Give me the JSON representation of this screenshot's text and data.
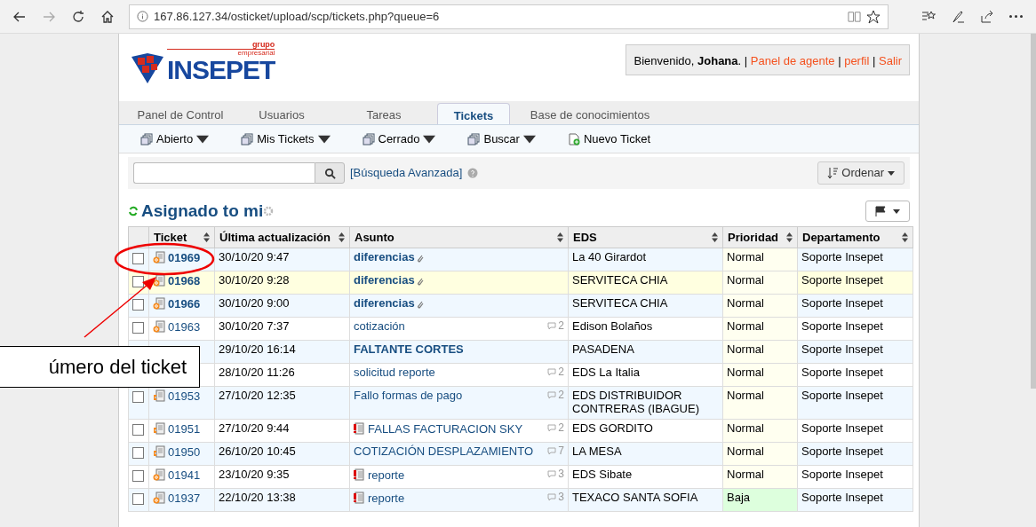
{
  "browser": {
    "url": "167.86.127.34/osticket/upload/scp/tickets.php?queue=6"
  },
  "logo": {
    "small_top": "grupo",
    "small_bottom": "empresarial",
    "name": "INSEPET"
  },
  "welcome": {
    "greeting": "Bienvenido, ",
    "user": "Johana",
    "user_suffix": ".",
    "separator": "|",
    "links": [
      "Panel de agente",
      "perfil",
      "Salir"
    ]
  },
  "tabs": [
    {
      "label": "Panel de Control",
      "selected": false
    },
    {
      "label": "Usuarios",
      "selected": false
    },
    {
      "label": "Tareas",
      "selected": false
    },
    {
      "label": "Tickets",
      "selected": true
    },
    {
      "label": "Base de conocimientos",
      "selected": false
    }
  ],
  "subnav": [
    {
      "label": "Abierto",
      "kind": "menu"
    },
    {
      "label": "Mis Tickets",
      "kind": "menu"
    },
    {
      "label": "Cerrado",
      "kind": "menu"
    },
    {
      "label": "Buscar",
      "kind": "menu"
    },
    {
      "label": "Nuevo Ticket",
      "kind": "new"
    }
  ],
  "search": {
    "advanced": "[Búsqueda Avanzada]",
    "sort": "Ordenar"
  },
  "queue_title": "Asignado to mi",
  "table": {
    "columns": [
      "Ticket",
      "Última actualización",
      "Asunto",
      "EDS",
      "Prioridad",
      "Departamento"
    ],
    "rows": [
      {
        "ticket": "01969",
        "kind": "email",
        "updated": "30/10/20 9:47",
        "subject": "diferencias",
        "unread": true,
        "attachment": true,
        "alert": false,
        "eds": "La 40 Girardot",
        "priority": "Normal",
        "color": "#fffff0",
        "department": "Soporte Insepet",
        "highlight": false
      },
      {
        "ticket": "01968",
        "kind": "email",
        "updated": "30/10/20 9:28",
        "subject": "diferencias",
        "unread": true,
        "attachment": true,
        "alert": false,
        "eds": "SERVITECA CHIA",
        "priority": "Normal",
        "color": "#fffff0",
        "department": "Soporte Insepet",
        "highlight": true
      },
      {
        "ticket": "01966",
        "kind": "email",
        "updated": "30/10/20 9:00",
        "subject": "diferencias",
        "unread": true,
        "attachment": true,
        "alert": false,
        "eds": "SERVITECA CHIA",
        "priority": "Normal",
        "color": "#fffff0",
        "department": "Soporte Insepet",
        "highlight": false
      },
      {
        "ticket": "01963",
        "kind": "email",
        "updated": "30/10/20 7:37",
        "subject": "cotización",
        "unread": false,
        "attachment": false,
        "alert": false,
        "threads": "2",
        "eds": "Edison Bolaños",
        "priority": "Normal",
        "color": "#fffff0",
        "department": "Soporte Insepet",
        "highlight": false
      },
      {
        "updated": "29/10/20 16:14",
        "subject": "FALTANTE CORTES",
        "unread": true,
        "attachment": false,
        "alert": false,
        "eds": "PASADENA",
        "priority": "Normal",
        "color": "#fffff0",
        "department": "Soporte Insepet",
        "highlight": false
      },
      {
        "updated": "28/10/20 11:26",
        "subject": "solicitud reporte",
        "unread": false,
        "attachment": false,
        "alert": false,
        "threads": "2",
        "eds": "EDS La Italia",
        "priority": "Normal",
        "color": "#fffff0",
        "department": "Soporte Insepet",
        "highlight": false
      },
      {
        "ticket": "01953",
        "kind": "phone",
        "updated": "27/10/20 12:35",
        "subject": "Fallo formas de pago",
        "unread": false,
        "attachment": false,
        "alert": false,
        "threads": "2",
        "eds": "EDS DISTRIBUIDOR CONTRERAS (IBAGUE)",
        "priority": "Normal",
        "color": "#fffff0",
        "department": "Soporte Insepet",
        "highlight": false
      },
      {
        "ticket": "01951",
        "kind": "phone",
        "updated": "27/10/20 9:44",
        "subject": "FALLAS FACTURACION SKY",
        "unread": false,
        "attachment": false,
        "alert": true,
        "threads": "2",
        "eds": "EDS GORDITO",
        "priority": "Normal",
        "color": "#fffff0",
        "department": "Soporte Insepet",
        "highlight": false
      },
      {
        "ticket": "01950",
        "kind": "phone",
        "updated": "26/10/20 10:45",
        "subject": "COTIZACIÓN DESPLAZAMIENTO",
        "unread": false,
        "attachment": false,
        "alert": false,
        "threads": "7",
        "eds": "LA MESA",
        "priority": "Normal",
        "color": "#fffff0",
        "department": "Soporte Insepet",
        "highlight": false
      },
      {
        "ticket": "01941",
        "kind": "email",
        "updated": "23/10/20 9:35",
        "subject": "reporte",
        "unread": false,
        "attachment": false,
        "alert": true,
        "threads": "3",
        "eds": "EDS Sibate",
        "priority": "Normal",
        "color": "#fffff0",
        "department": "Soporte Insepet",
        "highlight": false
      },
      {
        "ticket": "01937",
        "kind": "email",
        "updated": "22/10/20 13:38",
        "subject": "reporte",
        "unread": false,
        "attachment": false,
        "alert": true,
        "threads": "3",
        "eds": "TEXACO SANTA SOFIA",
        "priority": "Baja",
        "color": "#ddffdd",
        "department": "Soporte Insepet",
        "highlight": false
      }
    ]
  },
  "annotation": {
    "callout": "úmero del ticket"
  }
}
